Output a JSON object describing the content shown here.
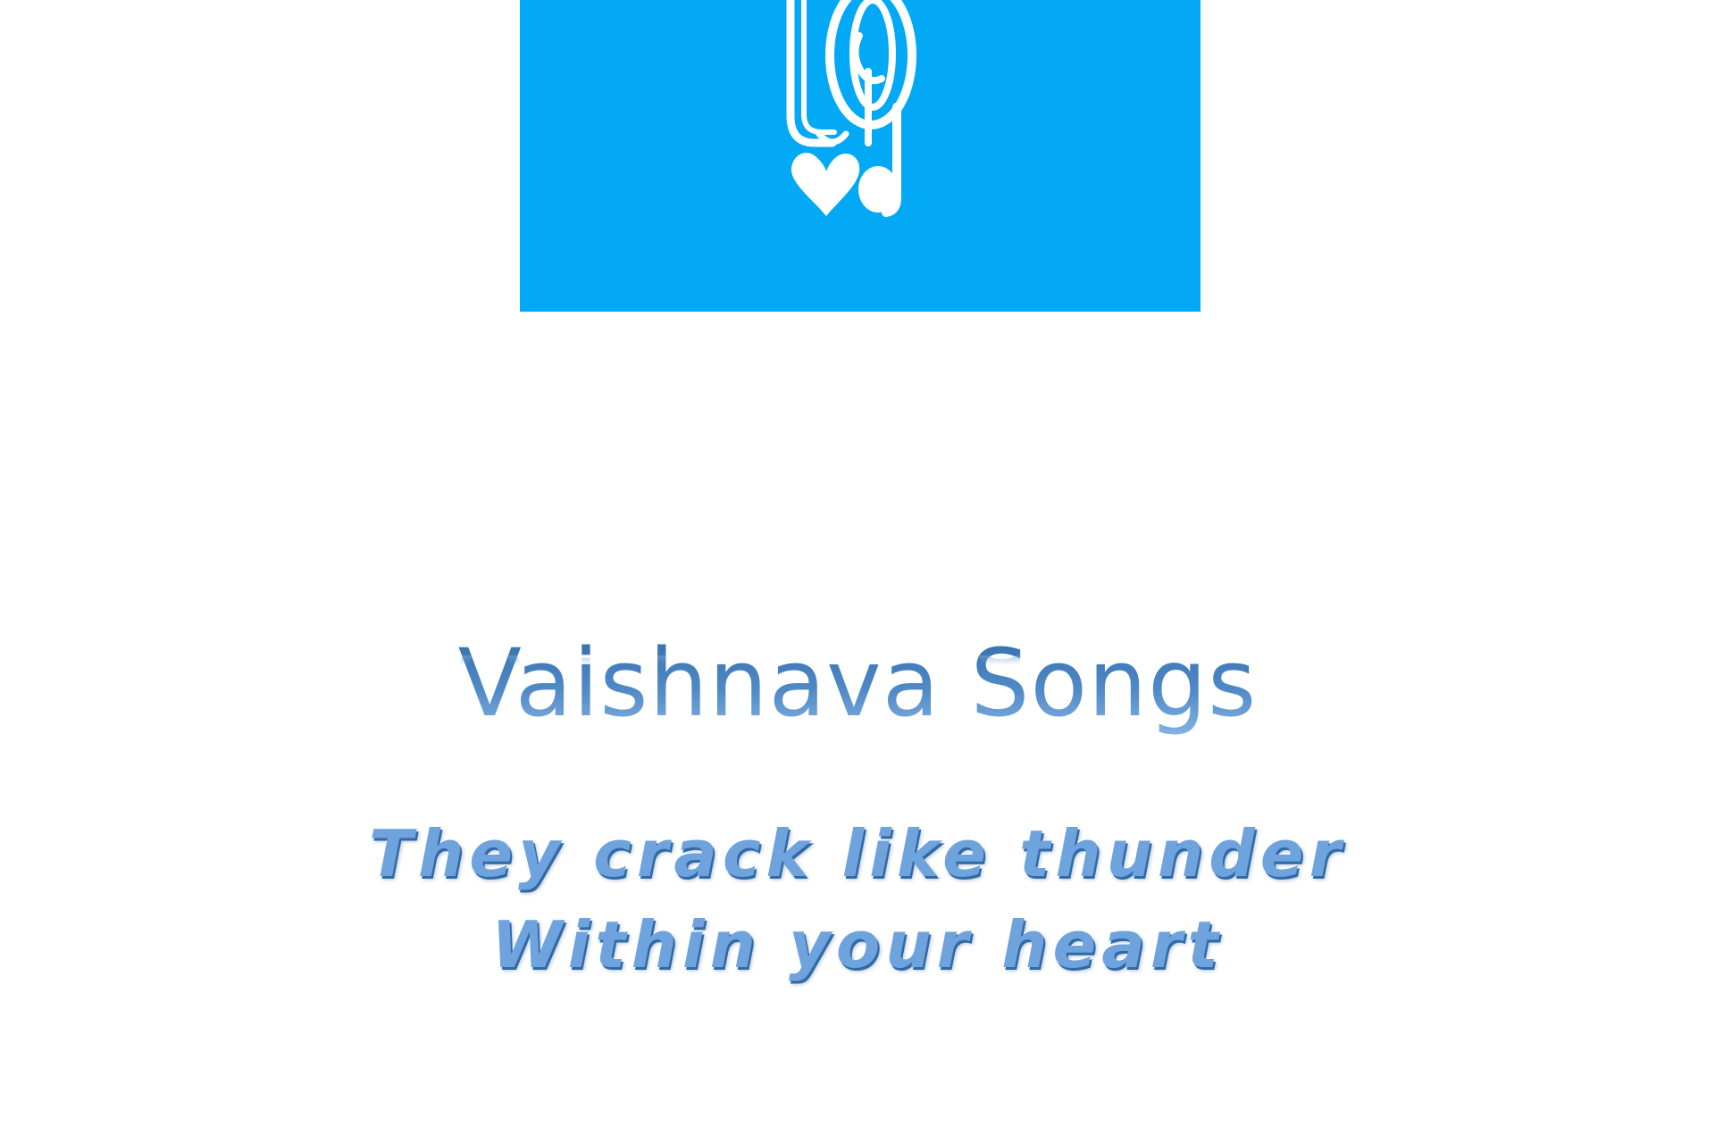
{
  "cover": {
    "logo": {
      "icon": "music-note-heart-logo-icon",
      "background_color": "#03a9f4",
      "foreground_color": "#ffffff"
    },
    "title": "Vaishnava Songs",
    "tagline": {
      "line1": "They crack like thunder",
      "line2": "Within your heart"
    },
    "colors": {
      "title_dark": "#2f6aa8",
      "title_light": "#8bb8e6",
      "tagline_fill": "#6fa3dd",
      "tagline_shadow": "#2f6aa8"
    }
  }
}
